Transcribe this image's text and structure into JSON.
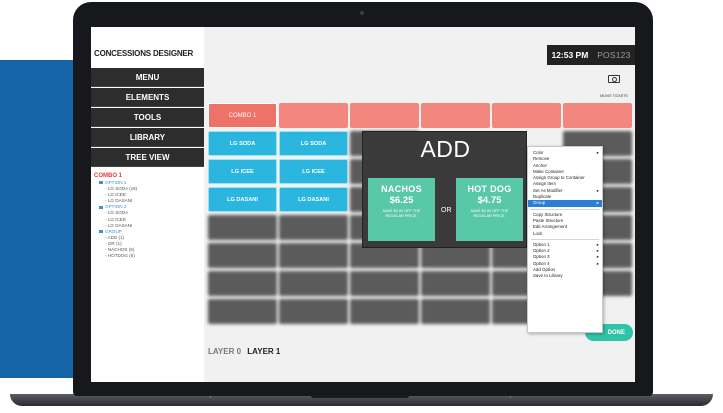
{
  "app": {
    "title": "CONCESSIONS DESIGNER"
  },
  "sidebar": {
    "menu_items": [
      {
        "label": "MENU"
      },
      {
        "label": "ELEMENTS"
      },
      {
        "label": "TOOLS"
      },
      {
        "label": "LIBRARY"
      },
      {
        "label": "TREE VIEW"
      }
    ]
  },
  "tree": {
    "root": "COMBO 1",
    "nodes": [
      {
        "type": "folder",
        "label": "OPTION 1"
      },
      {
        "type": "leaf",
        "label": "LG SODA (x6)"
      },
      {
        "type": "leaf",
        "label": "LG ICEE"
      },
      {
        "type": "leaf",
        "label": "LG DASANI"
      },
      {
        "type": "folder",
        "label": "OPTION 2"
      },
      {
        "type": "leaf",
        "label": "LG SODA"
      },
      {
        "type": "leaf",
        "label": "LG ICEE"
      },
      {
        "type": "leaf",
        "label": "LG DASANI"
      },
      {
        "type": "folder",
        "label": "GROUP"
      },
      {
        "type": "leaf",
        "label": "ADD (1)"
      },
      {
        "type": "leaf",
        "label": "OR (1)"
      },
      {
        "type": "leaf",
        "label": "NACHOS (6)"
      },
      {
        "type": "leaf",
        "label": "HOTDOG (6)"
      }
    ]
  },
  "header": {
    "time": "12:53 PM",
    "pos": "POS123",
    "tickets_label": "MOVIE TICKETS"
  },
  "grid": {
    "combo_label": "COMBO 1",
    "buttons": [
      "LG SODA",
      "LG SODA",
      "LG ICEE",
      "LG ICEE",
      "LG DASANI",
      "LG DASANI"
    ]
  },
  "popup": {
    "title": "ADD",
    "or_label": "OR",
    "options": [
      {
        "name": "NACHOS",
        "price": "$6.25",
        "desc": "SAVE $2.00 OFF THE REGULAR PRICE."
      },
      {
        "name": "HOT DOG",
        "price": "$4.75",
        "desc": "SAVE $2.00 OFF THE REGULAR PRICE."
      }
    ]
  },
  "context_menu": {
    "items": [
      {
        "label": "Color",
        "arrow": "▸"
      },
      {
        "label": "Remove"
      },
      {
        "label": "Anchor"
      },
      {
        "label": "Make Container"
      },
      {
        "label": "Assign Group to Container"
      },
      {
        "label": "Assign Item"
      },
      {
        "label": "Set As Modifier",
        "arrow": "▸"
      },
      {
        "label": "Duplicate"
      },
      {
        "label": "Group",
        "arrow": "▸",
        "selected": true
      },
      {
        "sep": true
      },
      {
        "label": "Copy Structure"
      },
      {
        "label": "Paste Structure"
      },
      {
        "label": "Edit Arrangement"
      },
      {
        "label": "Lock"
      },
      {
        "sep": true
      },
      {
        "label": "Option 1",
        "arrow": "▸"
      },
      {
        "label": "Option 2",
        "arrow": "▸"
      },
      {
        "label": "Option 3",
        "arrow": "▸"
      },
      {
        "label": "Option 4",
        "arrow": "▸"
      },
      {
        "label": "Add Option"
      },
      {
        "label": "Save to Library"
      }
    ]
  },
  "footer": {
    "layer0": "LAYER 0",
    "layer1": "LAYER 1",
    "done_label": "DONE"
  },
  "colors": {
    "brand_blue": "#1465a8",
    "combo_salmon": "#f3877f",
    "button_cyan": "#2bb6e0",
    "option_green": "#59c8a7",
    "done_teal": "#2ec4a8",
    "menu_highlight": "#2d7fd6"
  }
}
